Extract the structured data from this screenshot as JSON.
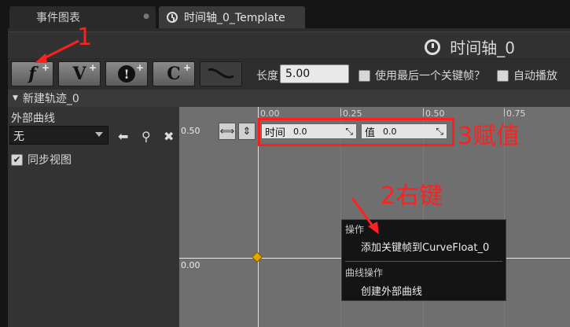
{
  "tabs": [
    {
      "label": "事件图表"
    },
    {
      "label": "时间轴_0_Template"
    }
  ],
  "header": {
    "title": "时间轴_0"
  },
  "toolbar": {
    "buttons": [
      {
        "glyph": "f",
        "icon": "add-float-track-icon"
      },
      {
        "glyph": "V",
        "icon": "add-vector-track-icon"
      },
      {
        "glyph": "!",
        "icon": "add-event-track-icon"
      },
      {
        "glyph": "C",
        "icon": "add-color-track-icon"
      },
      {
        "glyph": "",
        "icon": "add-external-curve-icon"
      }
    ],
    "length_label": "长度",
    "length_value": "5.00",
    "use_last_keyframe_label": "使用最后一个关键帧？",
    "autoplay_label": "自动播放"
  },
  "track": {
    "name": "新建轨迹_0",
    "external_curve_label": "外部曲线",
    "external_curve_value": "无",
    "sync_view_label": "同步视图",
    "sync_view_checked": true
  },
  "graph": {
    "ruler_labels": [
      "0.00",
      "0.25",
      "0.50",
      "0.75"
    ],
    "y_labels": {
      "top": "0.50",
      "zero": "0.00"
    },
    "time_label": "时间",
    "time_value": "0.0",
    "value_label": "值",
    "value_value": "0.0"
  },
  "context_menu": {
    "section1": "操作",
    "item1": "添加关键帧到CurveFloat_0",
    "section2": "曲线操作",
    "item2": "创建外部曲线"
  },
  "annotations": {
    "step1": "1",
    "step2": "2右键",
    "step3": "3赋值",
    "color": "#ff2020"
  }
}
